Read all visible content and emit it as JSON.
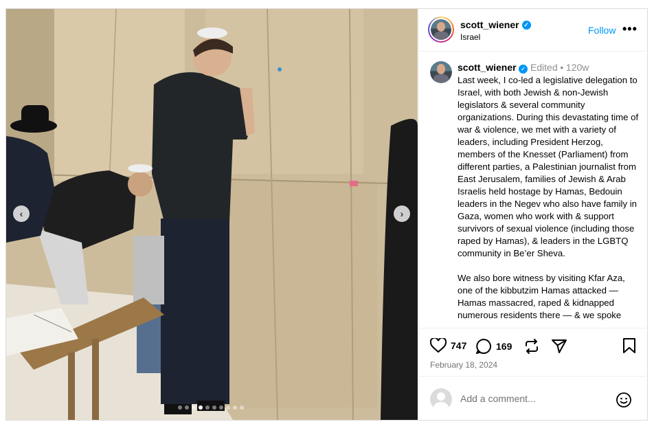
{
  "post": {
    "username": "scott_wiener",
    "location": "Israel",
    "follow_label": "Follow",
    "more_label": "•••",
    "caption": {
      "username": "scott_wiener",
      "edited": "Edited",
      "separator": "•",
      "age": "120w",
      "paragraph1": "Last week, I co-led a legislative delegation to Israel, with both Jewish & non-Jewish legislators & several community organizations. During this devastating time of war & violence, we met with a variety of leaders, including President Herzog, members of the Knesset (Parliament) from different parties, a Palestinian journalist from East Jerusalem, families of Jewish & Arab Israelis held hostage by Hamas, Bedouin leaders in the Negev who also have family in Gaza, women who work with & support survivors of sexual violence (including those raped by Hamas), & leaders in the LGBTQ community in Be’er Sheva.",
      "paragraph2": "We also bore witness by visiting Kfar Aza, one of the kibbutzim Hamas attacked — Hamas massacred, raped & kidnapped numerous residents there — & we spoke"
    },
    "likes": "747",
    "comments": "169",
    "date": "February 18, 2024",
    "comment_placeholder": "Add a comment..."
  },
  "carousel": {
    "prev_icon": "‹",
    "next_icon": "›",
    "dot_count": 10,
    "active_index": 3
  },
  "colors": {
    "accent": "#0095f6",
    "border": "#dbdbdb",
    "muted": "#737373"
  }
}
